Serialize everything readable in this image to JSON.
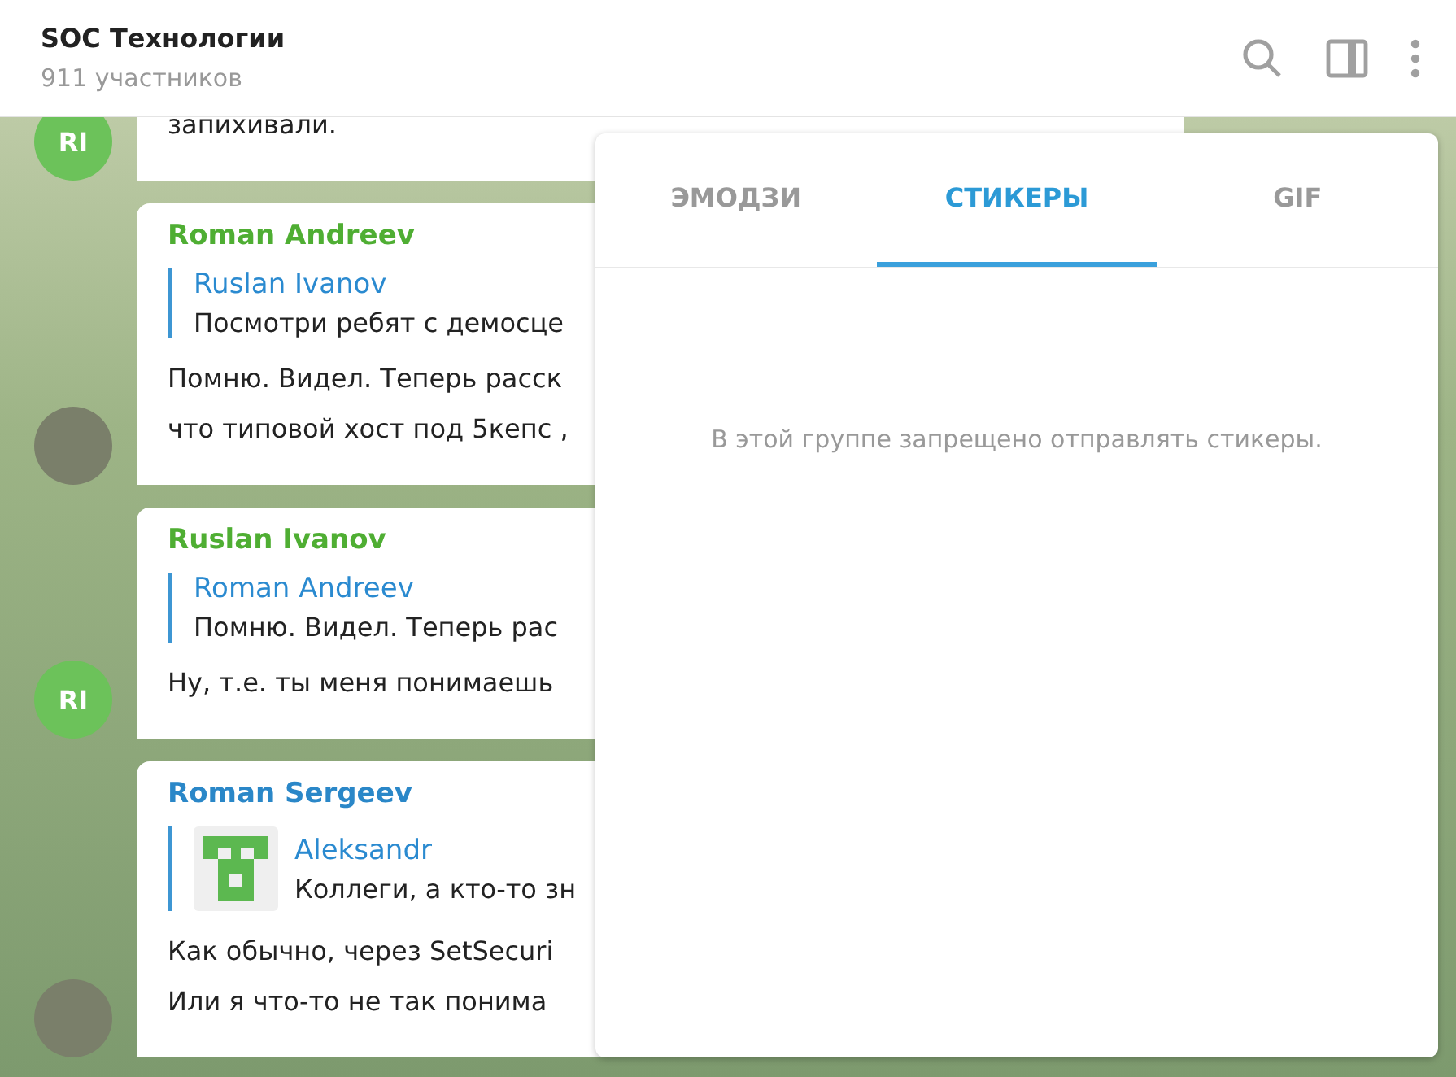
{
  "header": {
    "title": "SOC Технологии",
    "subtitle": "911 участников"
  },
  "messages": [
    {
      "avatar": {
        "kind": "initials",
        "initials": "RI"
      },
      "lines": [
        "запихивали."
      ]
    },
    {
      "sender": {
        "name": "Roman Andreev",
        "color": "#4fae33"
      },
      "avatar": {
        "kind": "photo"
      },
      "reply": {
        "name": "Ruslan Ivanov",
        "text": "Посмотри ребят с демосце",
        "thumb": false
      },
      "lines": [
        "Помню. Видел. Теперь расск",
        "что типовой хост под 5кепс ,"
      ]
    },
    {
      "sender": {
        "name": "Ruslan Ivanov",
        "color": "#4fae33"
      },
      "avatar": {
        "kind": "initials",
        "initials": "RI"
      },
      "reply": {
        "name": "Roman Andreev",
        "text": "Помню. Видел. Теперь рас",
        "thumb": false
      },
      "lines": [
        "Ну, т.е. ты меня понимаешь"
      ]
    },
    {
      "sender": {
        "name": "Roman Sergeev",
        "color": "#2a87c8"
      },
      "avatar": {
        "kind": "photo"
      },
      "reply": {
        "name": "Aleksandr",
        "text": "Коллеги, а кто-то зн",
        "thumb": true
      },
      "lines": [
        "Как обычно, через SetSecuri",
        "Или я что-то не так понима"
      ]
    }
  ],
  "panel": {
    "tabs": [
      {
        "label": "ЭМОДЗИ",
        "selected": false
      },
      {
        "label": "СТИКЕРЫ",
        "selected": true
      },
      {
        "label": "GIF",
        "selected": false
      }
    ],
    "message": "В этой группе запрещено отправлять стикеры."
  }
}
